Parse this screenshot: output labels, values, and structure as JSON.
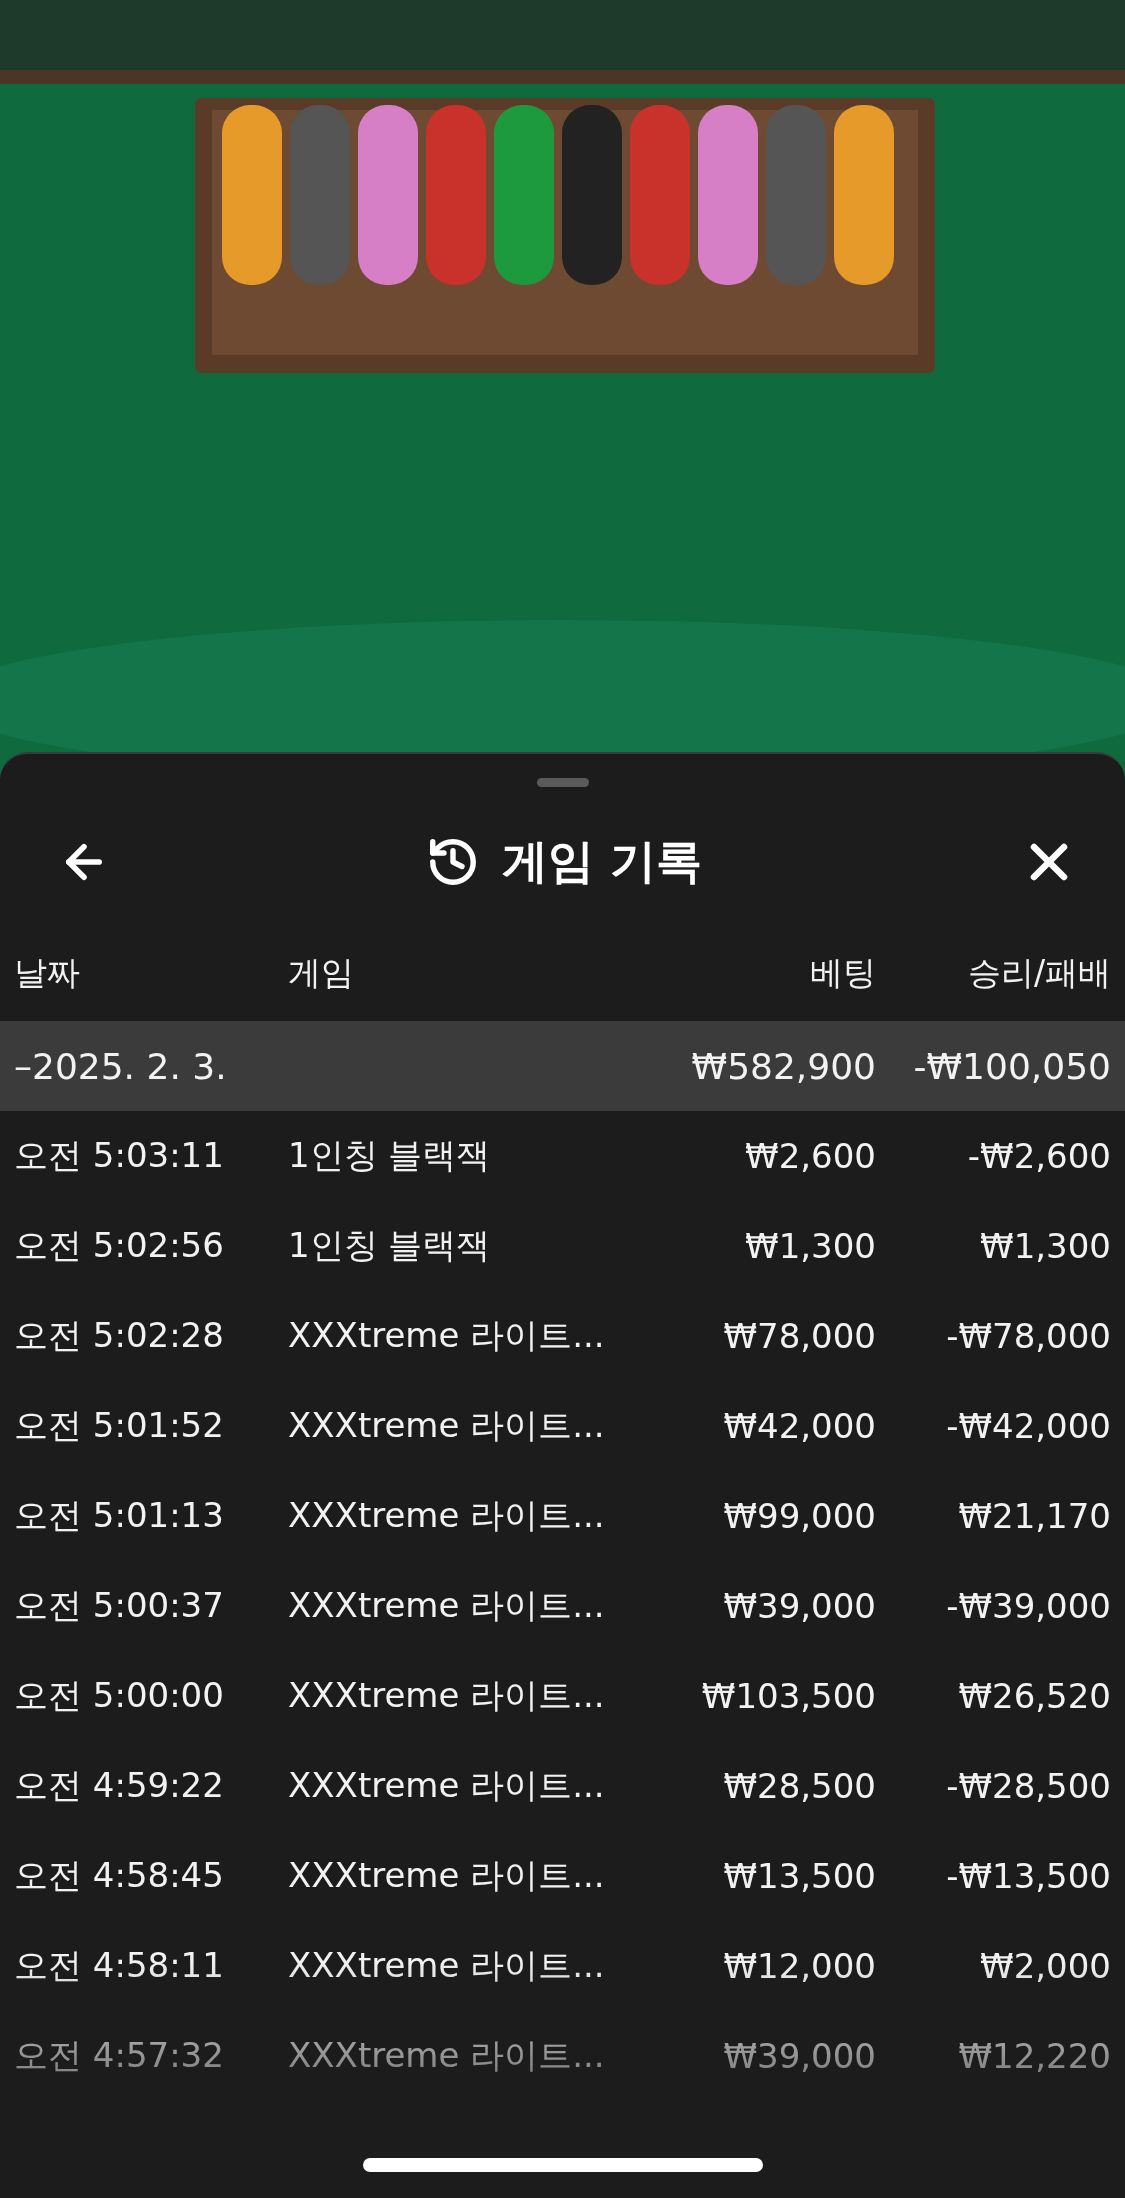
{
  "sheet": {
    "title": "게임 기록",
    "columns": [
      "날짜",
      "게임",
      "베팅",
      "승리/패배"
    ],
    "summary": {
      "date": "–2025. 2. 3.",
      "bet": "₩582,900",
      "result": "-₩100,050"
    },
    "rows": [
      {
        "time": "오전 5:03:11",
        "game": "1인칭 블랙잭",
        "bet": "₩2,600",
        "result": "-₩2,600"
      },
      {
        "time": "오전 5:02:56",
        "game": "1인칭 블랙잭",
        "bet": "₩1,300",
        "result": "₩1,300"
      },
      {
        "time": "오전 5:02:28",
        "game": "XXXtreme 라이트...",
        "bet": "₩78,000",
        "result": "-₩78,000"
      },
      {
        "time": "오전 5:01:52",
        "game": "XXXtreme 라이트...",
        "bet": "₩42,000",
        "result": "-₩42,000"
      },
      {
        "time": "오전 5:01:13",
        "game": "XXXtreme 라이트...",
        "bet": "₩99,000",
        "result": "₩21,170"
      },
      {
        "time": "오전 5:00:37",
        "game": "XXXtreme 라이트...",
        "bet": "₩39,000",
        "result": "-₩39,000"
      },
      {
        "time": "오전 5:00:00",
        "game": "XXXtreme 라이트...",
        "bet": "₩103,500",
        "result": "₩26,520"
      },
      {
        "time": "오전 4:59:22",
        "game": "XXXtreme 라이트...",
        "bet": "₩28,500",
        "result": "-₩28,500"
      },
      {
        "time": "오전 4:58:45",
        "game": "XXXtreme 라이트...",
        "bet": "₩13,500",
        "result": "-₩13,500"
      },
      {
        "time": "오전 4:58:11",
        "game": "XXXtreme 라이트...",
        "bet": "₩12,000",
        "result": "₩2,000"
      },
      {
        "time": "오전 4:57:32",
        "game": "XXXtreme 라이트...",
        "bet": "₩39,000",
        "result": "₩12,220"
      }
    ]
  }
}
